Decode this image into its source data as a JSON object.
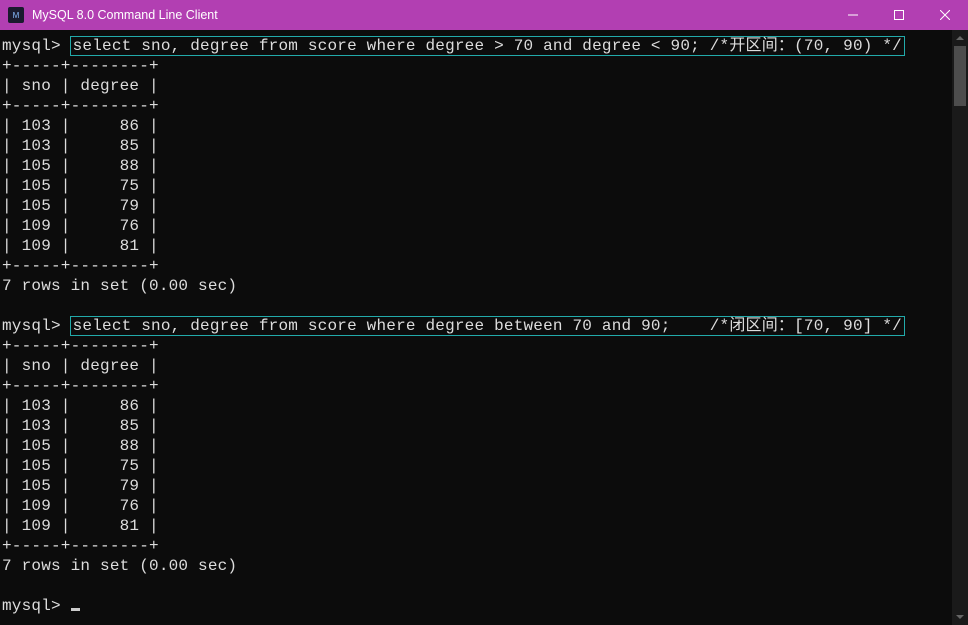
{
  "window": {
    "title": "MySQL 8.0 Command Line Client",
    "icon_label": "M"
  },
  "prompt": "mysql>",
  "queries": [
    {
      "sql": "select sno, degree from score where degree > 70 and degree < 90; /*开区间：(70, 90) */"
    },
    {
      "sql": "select sno, degree from score where degree between 70 and 90;    /*闭区间：[70, 90] */"
    }
  ],
  "table": {
    "separator": "+-----+--------+",
    "header": "| sno | degree |",
    "rows": [
      "| 103 |     86 |",
      "| 103 |     85 |",
      "| 105 |     88 |",
      "| 105 |     75 |",
      "| 105 |     79 |",
      "| 109 |     76 |",
      "| 109 |     81 |"
    ]
  },
  "rowcount_msg": "7 rows in set (0.00 sec)",
  "chart_data": {
    "type": "table",
    "columns": [
      "sno",
      "degree"
    ],
    "rows": [
      [
        103,
        86
      ],
      [
        103,
        85
      ],
      [
        105,
        88
      ],
      [
        105,
        75
      ],
      [
        105,
        79
      ],
      [
        109,
        76
      ],
      [
        109,
        81
      ]
    ],
    "row_count": 7,
    "elapsed_sec": 0.0
  }
}
